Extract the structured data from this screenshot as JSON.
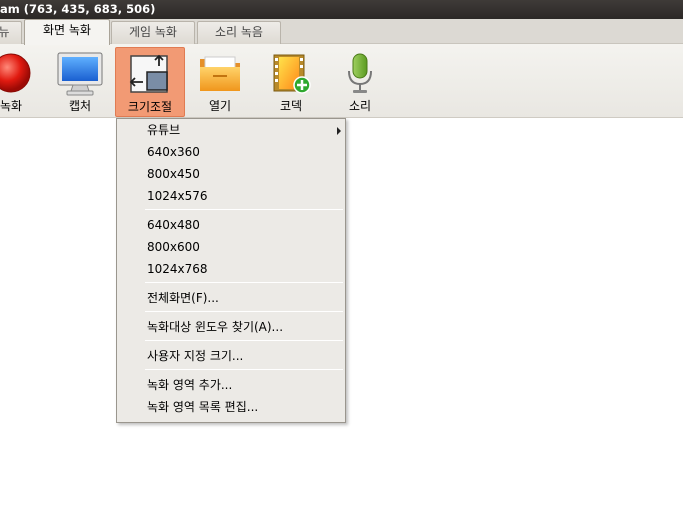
{
  "window": {
    "title": "am (763, 435, 683, 506)"
  },
  "tabs": [
    {
      "label": "뉴"
    },
    {
      "label": "화면 녹화"
    },
    {
      "label": "게임 녹화"
    },
    {
      "label": "소리 녹음"
    }
  ],
  "toolbar": {
    "items": [
      {
        "label": "녹화",
        "icon": "record-icon"
      },
      {
        "label": "캡처",
        "icon": "monitor-icon"
      },
      {
        "label": "크기조절",
        "icon": "resize-icon"
      },
      {
        "label": "열기",
        "icon": "folder-icon"
      },
      {
        "label": "코덱",
        "icon": "film-plus-icon"
      },
      {
        "label": "소리",
        "icon": "microphone-icon"
      }
    ]
  },
  "menu": {
    "items": [
      {
        "label": "유튜브",
        "submenu": true
      },
      {
        "label": "640x360"
      },
      {
        "label": "800x450"
      },
      {
        "label": "1024x576"
      },
      {
        "label": "640x480"
      },
      {
        "label": "800x600"
      },
      {
        "label": "1024x768"
      },
      {
        "label": "전체화면(F)..."
      },
      {
        "label": "녹화대상 윈도우 찾기(A)..."
      },
      {
        "label": "사용자 지정 크기..."
      },
      {
        "label": "녹화 영역 추가..."
      },
      {
        "label": "녹화 영역 목록 편집..."
      }
    ]
  },
  "colors": {
    "selected_tool": "#f29a74",
    "titlebar": "#2f2c2a",
    "menu_bg": "#eceae6"
  }
}
